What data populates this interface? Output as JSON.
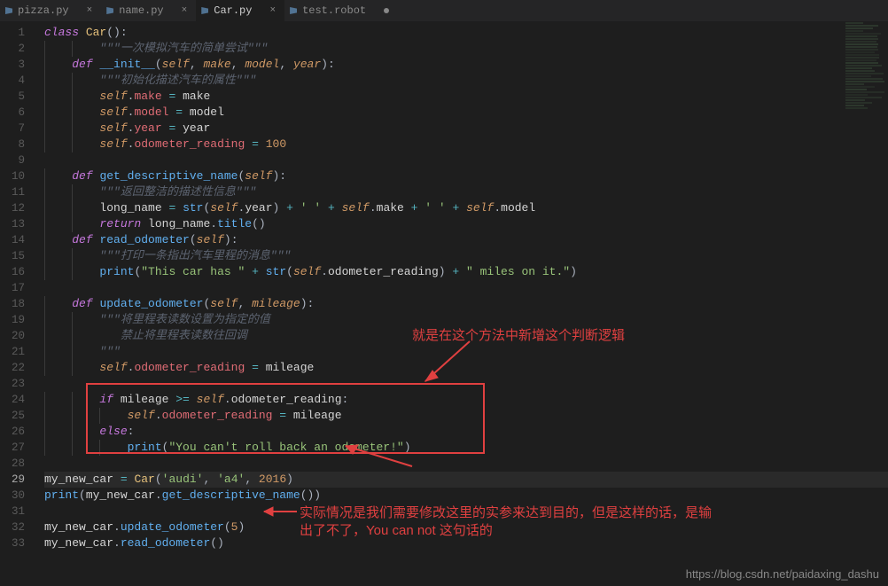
{
  "tabs": [
    {
      "label": "pizza.py",
      "active": false,
      "modified": false
    },
    {
      "label": "name.py",
      "active": false,
      "modified": false
    },
    {
      "label": "Car.py",
      "active": true,
      "modified": false
    },
    {
      "label": "test.robot",
      "active": false,
      "modified": true
    }
  ],
  "gutter_start": 1,
  "gutter_end": 33,
  "current_line": 29,
  "code_tokens": [
    [
      [
        "kw",
        "class"
      ],
      [
        "",
        ""
      ],
      [
        "cls",
        " Car"
      ],
      [
        "punc",
        "():"
      ]
    ],
    [
      [
        "",
        "        "
      ],
      [
        "cmt",
        "\"\"\"一次模拟汽车的简单尝试\"\"\""
      ]
    ],
    [
      [
        "",
        "    "
      ],
      [
        "kw",
        "def"
      ],
      [
        "",
        " "
      ],
      [
        "fn",
        "__init__"
      ],
      [
        "punc",
        "("
      ],
      [
        "self",
        "self"
      ],
      [
        "punc",
        ", "
      ],
      [
        "param",
        "make"
      ],
      [
        "punc",
        ", "
      ],
      [
        "param",
        "model"
      ],
      [
        "punc",
        ", "
      ],
      [
        "param",
        "year"
      ],
      [
        "punc",
        "):"
      ]
    ],
    [
      [
        "",
        "        "
      ],
      [
        "cmt",
        "\"\"\"初始化描述汽车的属性\"\"\""
      ]
    ],
    [
      [
        "",
        "        "
      ],
      [
        "self",
        "self"
      ],
      [
        "punc",
        "."
      ],
      [
        "attr",
        "make"
      ],
      [
        "",
        " "
      ],
      [
        "op",
        "="
      ],
      [
        "",
        " make"
      ]
    ],
    [
      [
        "",
        "        "
      ],
      [
        "self",
        "self"
      ],
      [
        "punc",
        "."
      ],
      [
        "attr",
        "model"
      ],
      [
        "",
        " "
      ],
      [
        "op",
        "="
      ],
      [
        "",
        " model"
      ]
    ],
    [
      [
        "",
        "        "
      ],
      [
        "self",
        "self"
      ],
      [
        "punc",
        "."
      ],
      [
        "attr",
        "year"
      ],
      [
        "",
        " "
      ],
      [
        "op",
        "="
      ],
      [
        "",
        " year"
      ]
    ],
    [
      [
        "",
        "        "
      ],
      [
        "self",
        "self"
      ],
      [
        "punc",
        "."
      ],
      [
        "attr",
        "odometer_reading"
      ],
      [
        "",
        " "
      ],
      [
        "op",
        "="
      ],
      [
        "",
        " "
      ],
      [
        "num",
        "100"
      ]
    ],
    [
      [
        "",
        ""
      ]
    ],
    [
      [
        "",
        "    "
      ],
      [
        "kw",
        "def"
      ],
      [
        "",
        " "
      ],
      [
        "fn",
        "get_descriptive_name"
      ],
      [
        "punc",
        "("
      ],
      [
        "self",
        "self"
      ],
      [
        "punc",
        "):"
      ]
    ],
    [
      [
        "",
        "        "
      ],
      [
        "cmt",
        "\"\"\"返回整洁的描述性信息\"\"\""
      ]
    ],
    [
      [
        "",
        "        long_name "
      ],
      [
        "op",
        "="
      ],
      [
        "",
        " "
      ],
      [
        "fn",
        "str"
      ],
      [
        "punc",
        "("
      ],
      [
        "self",
        "self"
      ],
      [
        "punc",
        "."
      ],
      [
        "",
        "year"
      ],
      [
        "punc",
        ") "
      ],
      [
        "op",
        "+"
      ],
      [
        "",
        " "
      ],
      [
        "str",
        "' '"
      ],
      [
        "",
        " "
      ],
      [
        "op",
        "+"
      ],
      [
        "",
        " "
      ],
      [
        "self",
        "self"
      ],
      [
        "punc",
        "."
      ],
      [
        "",
        "make "
      ],
      [
        "op",
        "+"
      ],
      [
        "",
        " "
      ],
      [
        "str",
        "' '"
      ],
      [
        "",
        " "
      ],
      [
        "op",
        "+"
      ],
      [
        "",
        " "
      ],
      [
        "self",
        "self"
      ],
      [
        "punc",
        "."
      ],
      [
        "",
        "model"
      ]
    ],
    [
      [
        "",
        "        "
      ],
      [
        "kw",
        "return"
      ],
      [
        "",
        " long_name"
      ],
      [
        "punc",
        "."
      ],
      [
        "fn",
        "title"
      ],
      [
        "punc",
        "()"
      ]
    ],
    [
      [
        "",
        "    "
      ],
      [
        "kw",
        "def"
      ],
      [
        "",
        " "
      ],
      [
        "fn",
        "read_odometer"
      ],
      [
        "punc",
        "("
      ],
      [
        "self",
        "self"
      ],
      [
        "punc",
        "):"
      ]
    ],
    [
      [
        "",
        "        "
      ],
      [
        "cmt",
        "\"\"\"打印一条指出汽车里程的消息\"\"\""
      ]
    ],
    [
      [
        "",
        "        "
      ],
      [
        "fn",
        "print"
      ],
      [
        "punc",
        "("
      ],
      [
        "str",
        "\"This car has \""
      ],
      [
        "",
        " "
      ],
      [
        "op",
        "+"
      ],
      [
        "",
        " "
      ],
      [
        "fn",
        "str"
      ],
      [
        "punc",
        "("
      ],
      [
        "self",
        "self"
      ],
      [
        "punc",
        "."
      ],
      [
        "",
        "odometer_reading"
      ],
      [
        "punc",
        ") "
      ],
      [
        "op",
        "+"
      ],
      [
        "",
        " "
      ],
      [
        "str",
        "\" miles on it.\""
      ],
      [
        "punc",
        ")"
      ]
    ],
    [
      [
        "",
        ""
      ]
    ],
    [
      [
        "",
        "    "
      ],
      [
        "kw",
        "def"
      ],
      [
        "",
        " "
      ],
      [
        "fn",
        "update_odometer"
      ],
      [
        "punc",
        "("
      ],
      [
        "self",
        "self"
      ],
      [
        "punc",
        ", "
      ],
      [
        "param",
        "mileage"
      ],
      [
        "punc",
        "):"
      ]
    ],
    [
      [
        "",
        "        "
      ],
      [
        "cmt",
        "\"\"\"将里程表读数设置为指定的值"
      ]
    ],
    [
      [
        "",
        "           "
      ],
      [
        "cmt",
        "禁止将里程表读数往回调"
      ]
    ],
    [
      [
        "",
        "        "
      ],
      [
        "cmt",
        "\"\"\""
      ]
    ],
    [
      [
        "",
        "        "
      ],
      [
        "self",
        "self"
      ],
      [
        "punc",
        "."
      ],
      [
        "attr",
        "odometer_reading"
      ],
      [
        "",
        " "
      ],
      [
        "op",
        "="
      ],
      [
        "",
        " mileage"
      ]
    ],
    [
      [
        "",
        ""
      ]
    ],
    [
      [
        "",
        "        "
      ],
      [
        "kw",
        "if"
      ],
      [
        "",
        " mileage "
      ],
      [
        "op",
        ">="
      ],
      [
        "",
        " "
      ],
      [
        "self",
        "self"
      ],
      [
        "punc",
        "."
      ],
      [
        "",
        "odometer_reading"
      ],
      [
        "punc",
        ":"
      ]
    ],
    [
      [
        "",
        "            "
      ],
      [
        "self",
        "self"
      ],
      [
        "punc",
        "."
      ],
      [
        "attr",
        "odometer_reading"
      ],
      [
        "",
        " "
      ],
      [
        "op",
        "="
      ],
      [
        "",
        " mileage"
      ]
    ],
    [
      [
        "",
        "        "
      ],
      [
        "kw",
        "else"
      ],
      [
        "punc",
        ":"
      ]
    ],
    [
      [
        "",
        "            "
      ],
      [
        "fn",
        "print"
      ],
      [
        "punc",
        "("
      ],
      [
        "str",
        "\"You can't roll back an odometer!\""
      ],
      [
        "punc",
        ")"
      ]
    ],
    [
      [
        "",
        ""
      ]
    ],
    [
      [
        "",
        "my_new_car "
      ],
      [
        "op",
        "="
      ],
      [
        "",
        " "
      ],
      [
        "cls",
        "Car"
      ],
      [
        "punc",
        "("
      ],
      [
        "str",
        "'audi'"
      ],
      [
        "punc",
        ", "
      ],
      [
        "str",
        "'a4'"
      ],
      [
        "punc",
        ", "
      ],
      [
        "num",
        "2016"
      ],
      [
        "punc",
        ")"
      ]
    ],
    [
      [
        "fn",
        "print"
      ],
      [
        "punc",
        "("
      ],
      [
        "",
        "my_new_car"
      ],
      [
        "punc",
        "."
      ],
      [
        "fn",
        "get_descriptive_name"
      ],
      [
        "punc",
        "())"
      ]
    ],
    [
      [
        "",
        ""
      ]
    ],
    [
      [
        "",
        "my_new_car"
      ],
      [
        "punc",
        "."
      ],
      [
        "fn",
        "update_odometer"
      ],
      [
        "punc",
        "("
      ],
      [
        "num",
        "5"
      ],
      [
        "punc",
        ")"
      ]
    ],
    [
      [
        "",
        "my_new_car"
      ],
      [
        "punc",
        "."
      ],
      [
        "fn",
        "read_odometer"
      ],
      [
        "punc",
        "()"
      ]
    ]
  ],
  "annotations": {
    "a1": "就是在这个方法中新增这个判断逻辑",
    "a2_l1": "实际情况是我们需要修改这里的实参来达到目的，但是这样的话，是输",
    "a2_l2": "出了不了，You can not 这句话的"
  },
  "watermark": "https://blog.csdn.net/paidaxing_dashu"
}
